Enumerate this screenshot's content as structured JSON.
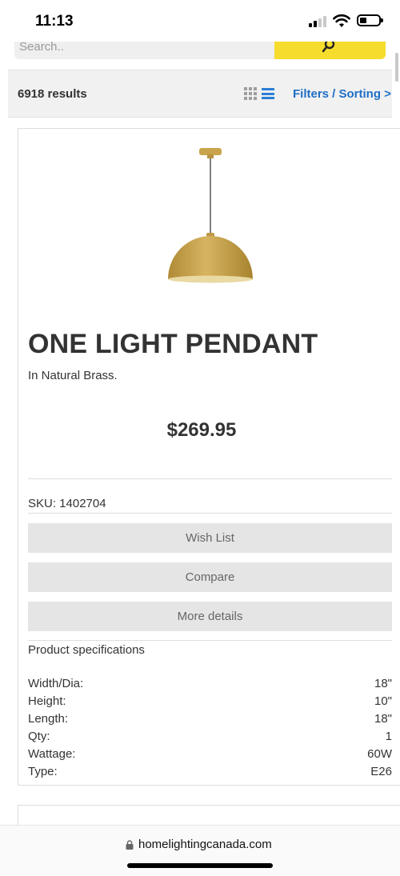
{
  "status_bar": {
    "time": "11:13"
  },
  "search": {
    "placeholder": "Search.."
  },
  "results": {
    "count_text": "6918 results",
    "filters_label": "Filters / Sorting >"
  },
  "product": {
    "title": "ONE LIGHT PENDANT",
    "subtitle": "In Natural Brass.",
    "price": "$269.95",
    "sku": "SKU: 1402704",
    "buttons": {
      "wishlist": "Wish List",
      "compare": "Compare",
      "details": "More details"
    },
    "specs_title": "Product specifications",
    "specs": [
      {
        "label": "Width/Dia:",
        "value": "18\""
      },
      {
        "label": "Height:",
        "value": "10\""
      },
      {
        "label": "Length:",
        "value": "18\""
      },
      {
        "label": "Qty:",
        "value": "1"
      },
      {
        "label": "Wattage:",
        "value": "60W"
      },
      {
        "label": "Type:",
        "value": "E26"
      }
    ]
  },
  "browser": {
    "url": "homelightingcanada.com"
  },
  "icons": {
    "grid_view": "grid-view-icon",
    "list_view": "list-view-icon",
    "search": "search-icon",
    "lock": "lock-icon"
  },
  "colors": {
    "search_button": "#f6dc2c",
    "link_blue": "#1e6fc5",
    "list_icon_active": "#2a7fd6",
    "brass": "#c8a24a"
  }
}
